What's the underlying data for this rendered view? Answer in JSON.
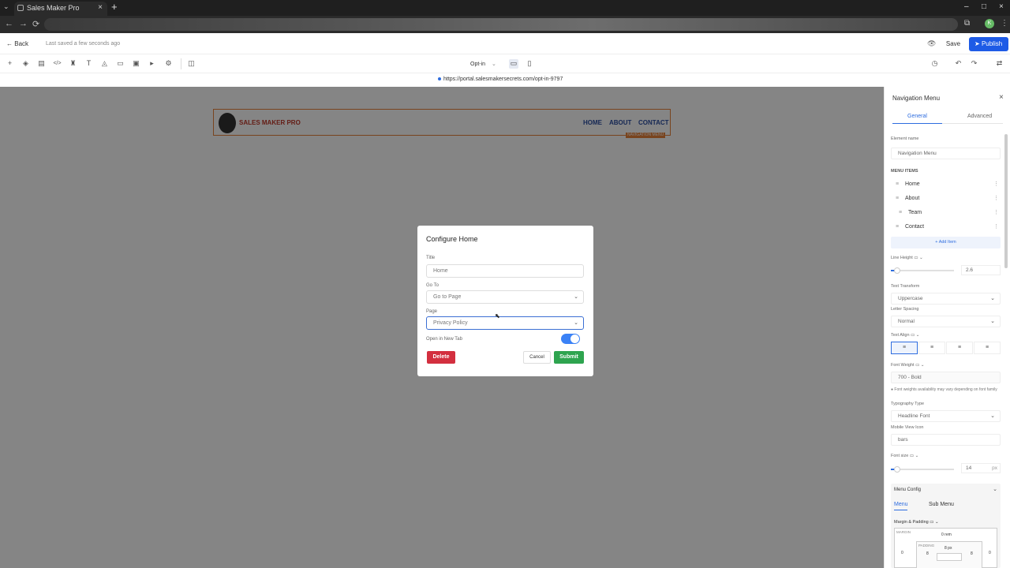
{
  "browser": {
    "tab_title": "Sales Maker Pro",
    "close_glyph": "×",
    "new_tab_glyph": "+",
    "menu_glyph": "⌄",
    "controls": {
      "minimize": "–",
      "maximize": "□",
      "close": "×"
    },
    "nav": {
      "back": "←",
      "forward": "→",
      "reload": "⟳"
    },
    "profile_initial": "K"
  },
  "header": {
    "back_label": "Back",
    "back_glyph": "←",
    "last_saved": "Last saved a few seconds ago",
    "save_label": "Save",
    "publish_label": "Publish",
    "publish_glyph": "➤",
    "preview_glyph": "👁"
  },
  "toolbar": {
    "icons": [
      "add-icon",
      "layers-icon",
      "pages-icon",
      "code-icon",
      "paint-icon",
      "text-icon",
      "shapes-icon",
      "layout-icon",
      "form-icon",
      "terminal-icon",
      "settings-icon"
    ],
    "glyphs": [
      "+",
      "◈",
      "▤",
      "</>",
      "♜",
      "T",
      "◬",
      "▭",
      "▣",
      "▸",
      "⚙"
    ],
    "layout_glyph": "◫",
    "page_selector": "Opt-in",
    "page_selector_chevron": "⌄",
    "desktop_glyph": "▭",
    "mobile_glyph": "▯",
    "history_glyph": "◷",
    "undo_glyph": "↶",
    "redo_glyph": "↷",
    "settings_glyph": "⇄"
  },
  "url": "https://portal.salesmakersecrets.com/opt-in-9797",
  "preview": {
    "brand": "SALES MAKER PRO",
    "links": [
      "HOME",
      "ABOUT",
      "CONTACT"
    ],
    "element_tag": "NAVIGATION MENU",
    "colors": {
      "brand": "#c0392b",
      "links": "#2b4ea2",
      "outline": "#e8823a"
    }
  },
  "modal": {
    "title": "Configure Home",
    "title_label": "Title",
    "title_value": "Home",
    "goto_label": "Go To",
    "goto_value": "Go to Page",
    "page_label": "Page",
    "page_value": "Privacy Policy",
    "new_tab_label": "Open in New Tab",
    "new_tab_enabled": true,
    "chevron": "⌄",
    "delete_label": "Delete",
    "cancel_label": "Cancel",
    "submit_label": "Submit",
    "colors": {
      "delete": "#d32f3f",
      "submit": "#2ea44f",
      "toggle": "#3b82f6"
    }
  },
  "panel": {
    "title": "Navigation Menu",
    "close_glyph": "×",
    "tabs": [
      "General",
      "Advanced"
    ],
    "element_name_label": "Element name",
    "element_name_value": "Navigation Menu",
    "menu_items_label": "MENU ITEMS",
    "menu_items": [
      "Home",
      "About",
      "Team",
      "Contact"
    ],
    "drag_glyph": "≡",
    "more_glyph": "⋮",
    "add_item_label": "+ Add Item",
    "line_height_label": "Line Height",
    "line_height_value": "2.6",
    "line_height_fraction": 0.1,
    "text_transform_label": "Text Transform",
    "text_transform_value": "Uppercase",
    "letter_spacing_label": "Letter Spacing",
    "letter_spacing_value": "Normal",
    "text_align_label": "Text Align",
    "align_glyphs": [
      "≡",
      "≡",
      "≡",
      "≡"
    ],
    "font_weight_label": "Font Weight",
    "font_weight_value": "700 - Bold",
    "font_note": "Font weights availability may vary depending on font family",
    "typography_label": "Typography Type",
    "typography_value": "Headline Font",
    "mobile_icon_label": "Mobile View Icon",
    "mobile_icon_value": "bars",
    "font_size_label": "Font size",
    "font_size_value": "14",
    "font_size_unit": "px",
    "font_size_fraction": 0.1,
    "menu_config_label": "Menu Config",
    "sub_tabs": [
      "Menu",
      "Sub Menu"
    ],
    "margin_padding_label": "Margin & Padding",
    "margin_label": "MARGIN",
    "margin_value": "0 rem",
    "padding_label": "PADDING",
    "padding_value": "8 px",
    "side_values": [
      "0",
      "8",
      "8",
      "0"
    ]
  }
}
